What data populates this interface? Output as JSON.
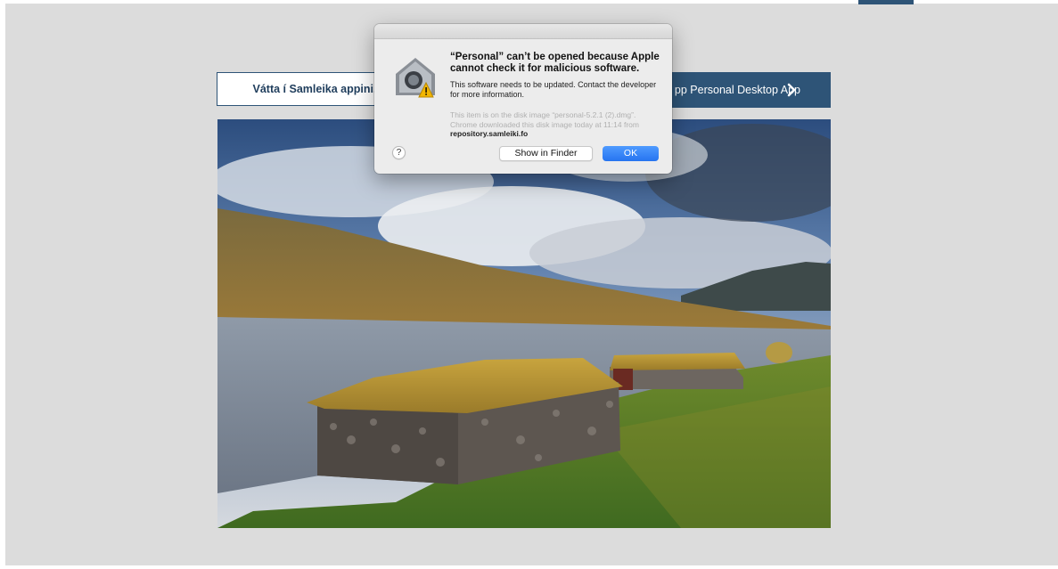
{
  "page": {
    "left_button_label": "Vátta í Samleika appini,",
    "right_button_label": "pp Personal Desktop App",
    "landscape_image": "faroese-stone-houses-lake",
    "icons": {
      "chevron": "chevron-right-icon",
      "gatekeeper": "gatekeeper-warning-icon"
    },
    "colors": {
      "brand": "#2e5477",
      "background": "#dcdcdc"
    }
  },
  "dialog": {
    "title": "“Personal” can’t be opened because Apple cannot check it for malicious software.",
    "message": "This software needs to be updated. Contact the developer for more information.",
    "info_prefix": "This item is on the disk image “personal-5.2.1 (2).dmg”. Chrome downloaded this disk image today at 11:14 from",
    "info_source": "repository.samleiki.fo",
    "help_label": "?",
    "show_in_finder_label": "Show in Finder",
    "ok_label": "OK"
  }
}
